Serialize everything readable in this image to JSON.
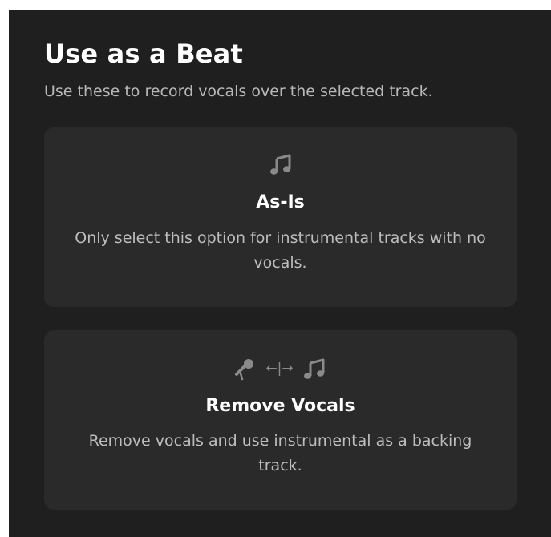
{
  "header": {
    "title": "Use as a Beat",
    "subtitle": "Use these to record vocals over the selected track."
  },
  "options": [
    {
      "id": "as-is",
      "icon": "music-note-icon",
      "title": "As-Is",
      "description": "Only select this option for instrumental tracks with no vocals."
    },
    {
      "id": "remove-vocals",
      "icons": [
        "microphone-icon",
        "swap-arrows-icon",
        "music-note-icon"
      ],
      "arrows": "←|→",
      "title": "Remove Vocals",
      "description": "Remove vocals and use instrumental as a backing track."
    }
  ],
  "colors": {
    "background": "#1f1f1f",
    "card": "#2a2a2a",
    "text": "#ffffff",
    "muted": "#b8b8b8",
    "icon": "#8a8a8a"
  }
}
